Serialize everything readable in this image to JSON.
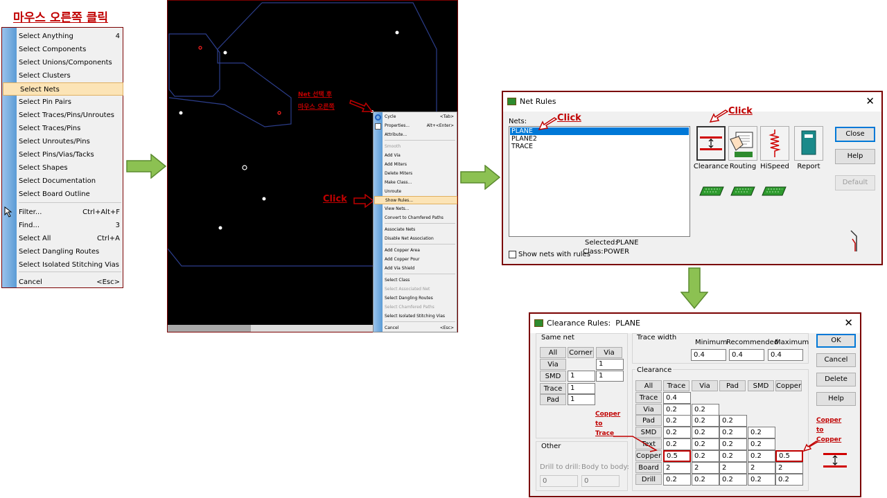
{
  "heading": "마우스 오른쪽 클릭",
  "context_menu": {
    "items": [
      {
        "label": "Select Anything",
        "shortcut": "4"
      },
      {
        "label": "Select Components",
        "shortcut": ""
      },
      {
        "label": "Select Unions/Components",
        "shortcut": ""
      },
      {
        "label": "Select Clusters",
        "shortcut": ""
      },
      {
        "label": "Select Nets",
        "shortcut": ""
      },
      {
        "label": "Select Pin Pairs",
        "shortcut": ""
      },
      {
        "label": "Select Traces/Pins/Unroutes",
        "shortcut": ""
      },
      {
        "label": "Select Traces/Pins",
        "shortcut": ""
      },
      {
        "label": "Select Unroutes/Pins",
        "shortcut": ""
      },
      {
        "label": "Select Pins/Vias/Tacks",
        "shortcut": ""
      },
      {
        "label": "Select Shapes",
        "shortcut": ""
      },
      {
        "label": "Select Documentation",
        "shortcut": ""
      },
      {
        "label": "Select Board Outline",
        "shortcut": ""
      },
      {
        "label": "Filter...",
        "shortcut": "Ctrl+Alt+F"
      },
      {
        "label": "Find...",
        "shortcut": "3"
      },
      {
        "label": "Select All",
        "shortcut": "Ctrl+A"
      },
      {
        "label": "Select Dangling Routes",
        "shortcut": ""
      },
      {
        "label": "Select Isolated Stitching Vias",
        "shortcut": ""
      },
      {
        "label": "Cancel",
        "shortcut": "<Esc>"
      }
    ]
  },
  "pcb_menu": {
    "note_line1": "Net 선택 후",
    "note_line2": "마우스 오른쪽",
    "click_label": "Click",
    "items": [
      {
        "label": "Cycle",
        "shortcut": "<Tab>",
        "disabled": false
      },
      {
        "label": "Properties...",
        "shortcut": "Alt+<Enter>",
        "disabled": false
      },
      {
        "label": "Attribute...",
        "shortcut": "",
        "disabled": false
      },
      {
        "label": "Smooth",
        "shortcut": "",
        "disabled": true
      },
      {
        "label": "Add Via",
        "shortcut": "",
        "disabled": false
      },
      {
        "label": "Add Miters",
        "shortcut": "",
        "disabled": false
      },
      {
        "label": "Delete Miters",
        "shortcut": "",
        "disabled": false
      },
      {
        "label": "Make Class...",
        "shortcut": "",
        "disabled": false
      },
      {
        "label": "Unroute",
        "shortcut": "",
        "disabled": false
      },
      {
        "label": "Show Rules...",
        "shortcut": "",
        "disabled": false
      },
      {
        "label": "View Nets...",
        "shortcut": "",
        "disabled": false
      },
      {
        "label": "Convert to Chamfered Paths",
        "shortcut": "",
        "disabled": false
      },
      {
        "label": "Associate Nets",
        "shortcut": "",
        "disabled": false
      },
      {
        "label": "Disable Net Association",
        "shortcut": "",
        "disabled": false
      },
      {
        "label": "Add Copper Area",
        "shortcut": "",
        "disabled": false
      },
      {
        "label": "Add Copper Pour",
        "shortcut": "",
        "disabled": false
      },
      {
        "label": "Add Via Shield",
        "shortcut": "",
        "disabled": false
      },
      {
        "label": "Select Class",
        "shortcut": "",
        "disabled": false
      },
      {
        "label": "Select Associated Net",
        "shortcut": "",
        "disabled": true
      },
      {
        "label": "Select Dangling Routes",
        "shortcut": "",
        "disabled": false
      },
      {
        "label": "Select Chamfered Paths",
        "shortcut": "",
        "disabled": true
      },
      {
        "label": "Select Isolated Stitching Vias",
        "shortcut": "",
        "disabled": false
      },
      {
        "label": "Cancel",
        "shortcut": "<Esc>",
        "disabled": false
      }
    ]
  },
  "net_rules": {
    "title": "Net Rules",
    "nets_label": "Nets:",
    "nets": [
      "PLANE",
      "PLANE2",
      "TRACE"
    ],
    "click_label1": "Click",
    "click_label2": "Click",
    "show_nets_label": "Show nets with rules",
    "selected_label": "Selected:",
    "selected_value": "PLANE",
    "class_label": "Class:",
    "class_value": "POWER",
    "icon_buttons": [
      "Clearance",
      "Routing",
      "HiSpeed",
      "Report"
    ],
    "buttons": {
      "close": "Close",
      "help": "Help",
      "default": "Default"
    }
  },
  "clearance_rules": {
    "title": "Clearance Rules:",
    "title_net": "PLANE",
    "same_net": {
      "label": "Same net",
      "headers": [
        "All",
        "Corner",
        "Via"
      ],
      "rows": [
        {
          "label": "Via",
          "values": [
            "",
            "1"
          ]
        },
        {
          "label": "SMD",
          "values": [
            "1",
            "1"
          ]
        },
        {
          "label": "Trace",
          "values": [
            "1",
            ""
          ]
        },
        {
          "label": "Pad",
          "values": [
            "1",
            ""
          ]
        }
      ]
    },
    "other": {
      "label": "Other",
      "drill_to_drill_label": "Drill to drill:",
      "drill_to_drill": "0",
      "body_to_body_label": "Body to body:",
      "body_to_body": "0"
    },
    "trace_width": {
      "label": "Trace width",
      "minimum_label": "Minimum",
      "recommended_label": "Recommended",
      "maximum_label": "Maximum",
      "minimum": "0.4",
      "recommended": "0.4",
      "maximum": "0.4"
    },
    "clearance": {
      "label": "Clearance",
      "col_headers": [
        "All",
        "Trace",
        "Via",
        "Pad",
        "SMD",
        "Copper"
      ],
      "rows": [
        {
          "label": "Trace",
          "values": [
            "0.4"
          ]
        },
        {
          "label": "Via",
          "values": [
            "0.2",
            "0.2"
          ]
        },
        {
          "label": "Pad",
          "values": [
            "0.2",
            "0.2",
            "0.2"
          ]
        },
        {
          "label": "SMD",
          "values": [
            "0.2",
            "0.2",
            "0.2",
            "0.2"
          ]
        },
        {
          "label": "Text",
          "values": [
            "0.2",
            "0.2",
            "0.2",
            "0.2"
          ]
        },
        {
          "label": "Copper",
          "values": [
            "0.5",
            "0.2",
            "0.2",
            "0.2",
            "0.5"
          ]
        },
        {
          "label": "Board",
          "values": [
            "2",
            "2",
            "2",
            "2",
            "2"
          ]
        },
        {
          "label": "Drill",
          "values": [
            "0.2",
            "0.2",
            "0.2",
            "0.2",
            "0.2"
          ]
        }
      ]
    },
    "note_left": [
      "Copper",
      "to",
      "Trace"
    ],
    "note_right": [
      "Copper",
      "to",
      "Copper"
    ],
    "buttons": {
      "ok": "OK",
      "cancel": "Cancel",
      "delete": "Delete",
      "help": "Help"
    }
  },
  "colors": {
    "accent_red": "#c00000",
    "arrow_green": "#8cc152",
    "board_green": "#2e8b2e",
    "outline_blue": "#2c3e8c"
  }
}
